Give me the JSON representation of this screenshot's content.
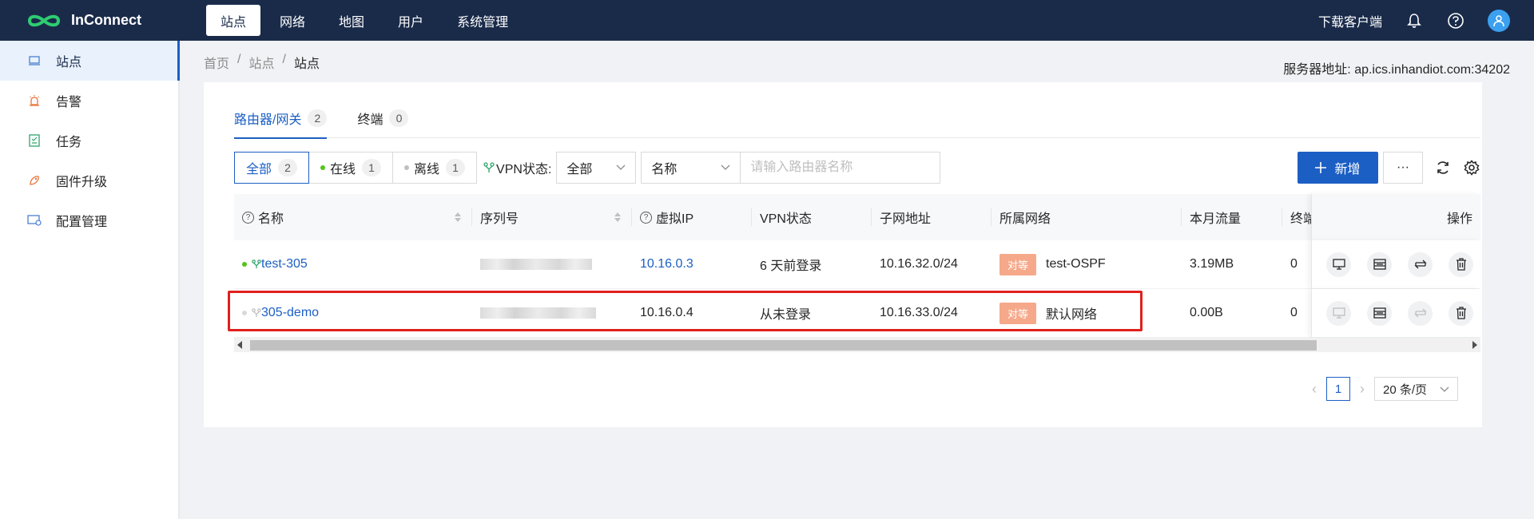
{
  "brand": {
    "name": "InConnect"
  },
  "nav": {
    "items": [
      {
        "label": "站点",
        "active": true
      },
      {
        "label": "网络"
      },
      {
        "label": "地图"
      },
      {
        "label": "用户"
      },
      {
        "label": "系统管理"
      }
    ]
  },
  "top_right": {
    "download_label": "下载客户端",
    "icons": [
      "bell-icon",
      "help-icon",
      "user-icon"
    ]
  },
  "sidebar": {
    "items": [
      {
        "label": "站点",
        "icon": "site-icon",
        "active": true
      },
      {
        "label": "告警",
        "icon": "alarm-icon"
      },
      {
        "label": "任务",
        "icon": "task-icon"
      },
      {
        "label": "固件升级",
        "icon": "firmware-icon"
      },
      {
        "label": "配置管理",
        "icon": "config-icon"
      }
    ]
  },
  "breadcrumb": {
    "items": [
      "首页",
      "站点",
      "站点"
    ],
    "separator": "/"
  },
  "server": {
    "label": "服务器地址: ap.ics.inhandiot.com:34202"
  },
  "tabs": [
    {
      "label": "路由器/网关",
      "count": "2",
      "active": true
    },
    {
      "label": "终端",
      "count": "0"
    }
  ],
  "filters": {
    "status": [
      {
        "label": "全部",
        "count": "2",
        "active": true
      },
      {
        "label": "在线",
        "count": "1",
        "dot": "#52c41a"
      },
      {
        "label": "离线",
        "count": "1",
        "dot": "#bfbfbf"
      }
    ],
    "vpn_label": "VPN状态:",
    "vpn_select": "全部",
    "field_select": "名称",
    "search_placeholder": "请输入路由器名称"
  },
  "actions": {
    "add_label": "新增",
    "more_label": "···"
  },
  "table": {
    "headers": [
      "名称",
      "序列号",
      "虚拟IP",
      "VPN状态",
      "子网地址",
      "所属网络",
      "本月流量",
      "终端",
      "操作"
    ],
    "rows": [
      {
        "name": "test-305",
        "online": true,
        "virtual_ip": "10.16.0.3",
        "vpn_status": "6 天前登录",
        "subnet": "10.16.32.0/24",
        "network_tag": "对等",
        "network": "test-OSPF",
        "traffic": "3.19MB",
        "terminals": "0"
      },
      {
        "name": "305-demo",
        "online": false,
        "virtual_ip": "10.16.0.4",
        "vpn_status": "从未登录",
        "subnet": "10.16.33.0/24",
        "network_tag": "对等",
        "network": "默认网络",
        "traffic": "0.00B",
        "terminals": "0"
      }
    ]
  },
  "pagination": {
    "current": "1",
    "page_size": "20 条/页"
  },
  "colors": {
    "primary": "#1c5fc4",
    "topbar": "#1a2b4a",
    "highlight": "#e0201d",
    "tag": "#f6a98a",
    "online": "#52c41a"
  }
}
